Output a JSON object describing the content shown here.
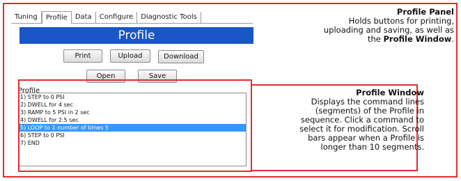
{
  "tabs": [
    {
      "label": "Tuning"
    },
    {
      "label": "Profile"
    },
    {
      "label": "Data"
    },
    {
      "label": "Configure"
    },
    {
      "label": "Diagnostic Tools"
    }
  ],
  "panel": {
    "title": "Profile",
    "buttons": {
      "print": "Print",
      "upload": "Upload",
      "download": "Download",
      "open": "Open",
      "save": "Save"
    },
    "list_label": "Profile",
    "list_items": [
      "1) STEP to 0 PSI",
      "2) DWELL for 4 sec",
      "3) RAMP to 5 PSI in 2 sec",
      "4) DWELL for 2.5 sec",
      "5) LOOP to 1 number of times 5",
      "6) STEP to 0 PSI",
      "7) END"
    ],
    "selected_index": 4
  },
  "annotations": {
    "profile_panel": {
      "heading": "Profile Panel",
      "line1": "Holds buttons for printing,",
      "line2": "uploading and saving, as well as",
      "line3_prefix": "the ",
      "line3_bold": "Profile Window",
      "line3_suffix": "."
    },
    "profile_window": {
      "heading": "Profile Window",
      "lines": [
        "Displays the command lines",
        "(segments) of the Profile in",
        "sequence. Click a command to",
        "select it for modification. Scroll",
        "bars appear when a Profile is",
        "longer than 10 segments."
      ]
    }
  },
  "colors": {
    "callout_border": "#e32b2b",
    "title_bar": "#1a56c5",
    "selection": "#3399ff"
  }
}
